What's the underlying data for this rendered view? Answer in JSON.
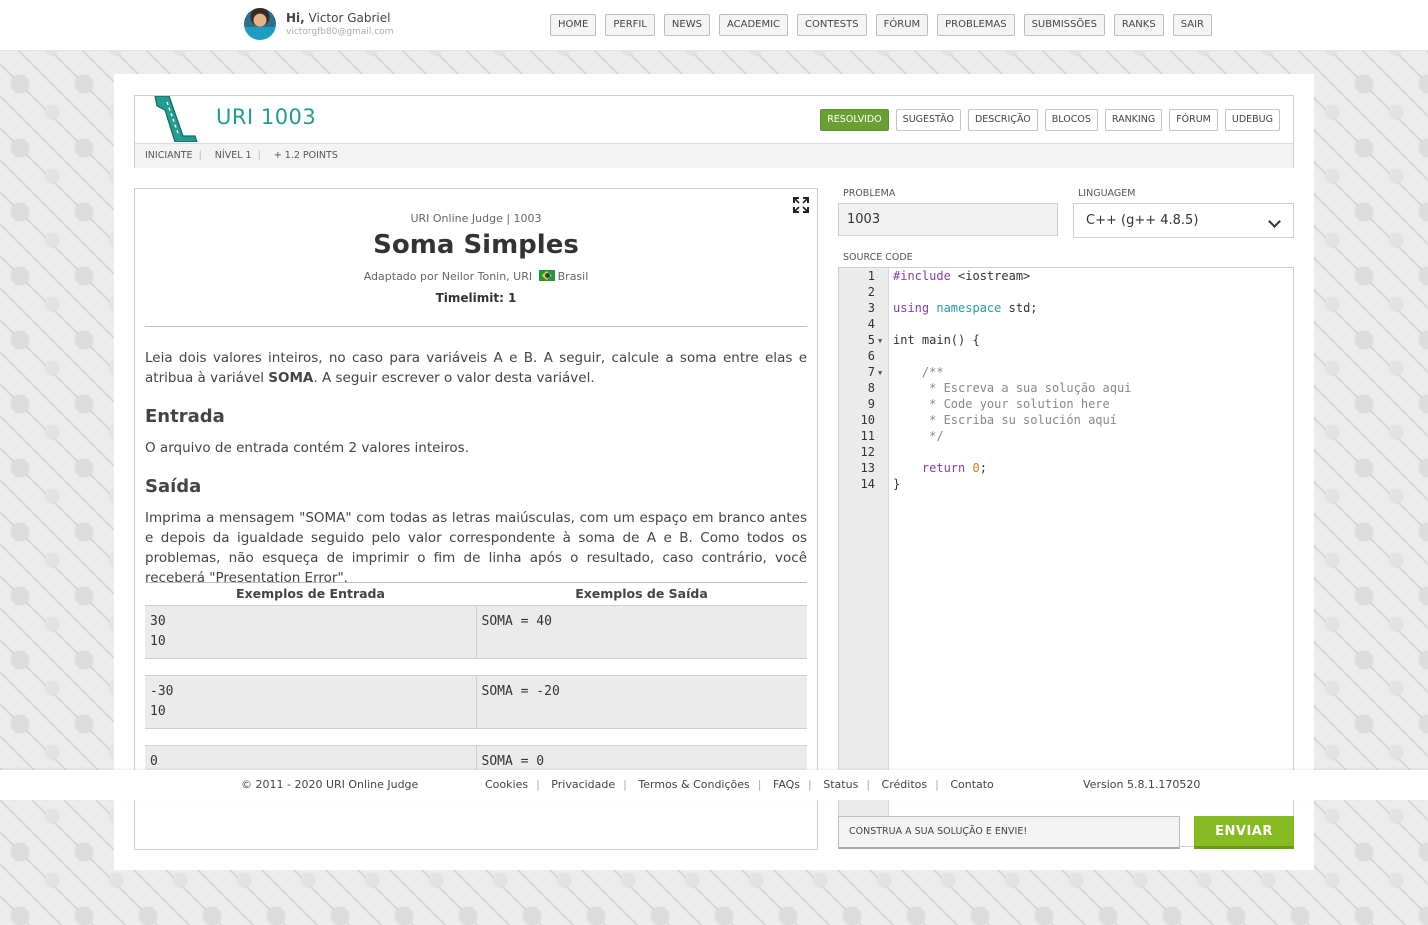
{
  "header": {
    "greeting": "Hi,",
    "user_name": "Victor Gabriel",
    "user_email": "victorgfb80@gmail.com",
    "nav": [
      "HOME",
      "PERFIL",
      "NEWS",
      "ACADEMIC",
      "CONTESTS",
      "FÓRUM",
      "PROBLEMAS",
      "SUBMISSÕES",
      "RANKS",
      "SAIR"
    ]
  },
  "problem": {
    "title": "URI 1003",
    "tabs": [
      "RESOLVIDO",
      "SUGESTÃO",
      "DESCRIÇÃO",
      "BLOCOS",
      "RANKING",
      "FÓRUM",
      "UDEBUG"
    ],
    "active_tab": "RESOLVIDO",
    "category": "INICIANTE",
    "level": "NÍVEL 1",
    "points": "+ 1.2 POINTS"
  },
  "description": {
    "judge": "URI Online Judge | 1003",
    "title": "Soma Simples",
    "adapted_by": "Adaptado por Neilor Tonin, URI",
    "country": "Brasil",
    "timelimit": "Timelimit: 1",
    "intro_before": "Leia dois valores inteiros, no caso para variáveis A e B. A seguir, calcule a soma entre elas e atribua à variável ",
    "intro_bold": "SOMA",
    "intro_after": ". A seguir escrever o valor desta variável.",
    "input_title": "Entrada",
    "input_text": "O arquivo de entrada contém 2 valores inteiros.",
    "output_title": "Saída",
    "output_text": "Imprima a mensagem \"SOMA\" com todas as letras maiúsculas, com um espaço em branco antes e depois da igualdade seguido pelo valor correspondente à soma de A e B. Como todos os problemas, não esqueça de imprimir o fim de linha após o resultado, caso contrário, você receberá \"Presentation Error\".",
    "examples_in_header": "Exemplos de Entrada",
    "examples_out_header": "Exemplos de Saída",
    "examples": [
      {
        "input": "30\n10",
        "output": "SOMA = 40"
      },
      {
        "input": "-30\n10",
        "output": "SOMA = -20"
      },
      {
        "input": "0\n0",
        "output": "SOMA = 0"
      }
    ]
  },
  "editor": {
    "problem_label": "PROBLEMA",
    "problem_value": "1003",
    "language_label": "LINGUAGEM",
    "language_value": "C++ (g++ 4.8.5)",
    "source_label": "SOURCE CODE",
    "line_numbers": [
      "1",
      "2",
      "3",
      "4",
      "5",
      "6",
      "7",
      "8",
      "9",
      "10",
      "11",
      "12",
      "13",
      "14"
    ],
    "submit_placeholder": "CONSTRUA A SUA SOLUÇÃO E ENVIE!",
    "send_label": "ENVIAR"
  },
  "footer": {
    "copyright": "© 2011 - 2020 URI Online Judge",
    "links": [
      "Cookies",
      "Privacidade",
      "Termos & Condições",
      "FAQs",
      "Status",
      "Créditos",
      "Contato"
    ],
    "version": "Version 5.8.1.170520"
  },
  "colors": {
    "accent_teal": "#1f9e91",
    "active_tab_green": "#6aa033",
    "send_green": "#86bc22"
  }
}
